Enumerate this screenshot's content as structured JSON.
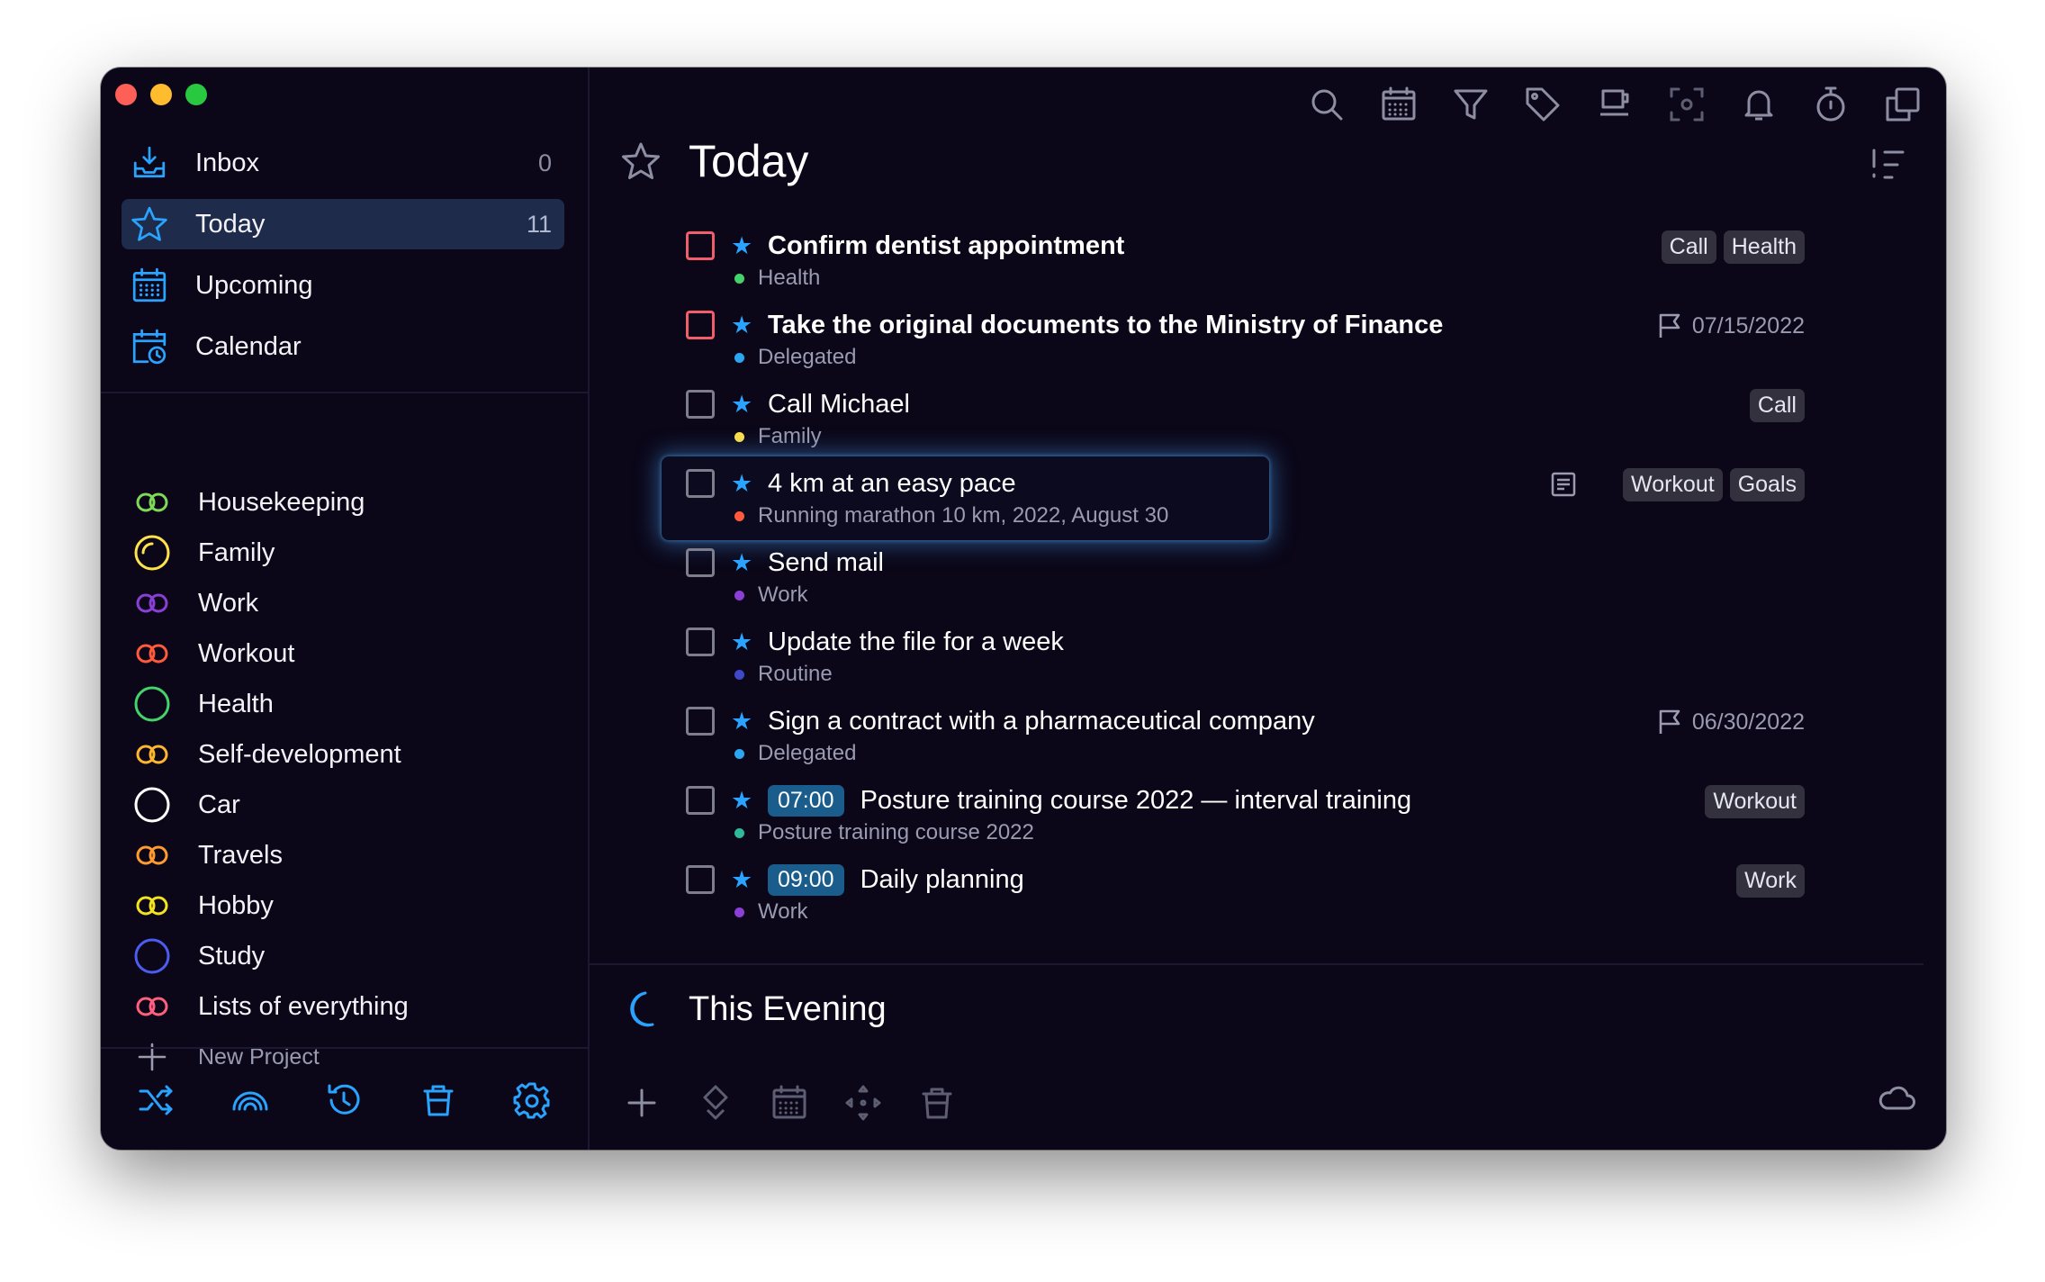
{
  "sidebar": {
    "nav": [
      {
        "label": "Inbox",
        "count": "0",
        "icon": "inbox-icon"
      },
      {
        "label": "Today",
        "count": "11",
        "icon": "star-icon"
      },
      {
        "label": "Upcoming",
        "count": "",
        "icon": "calendar-grid-icon"
      },
      {
        "label": "Calendar",
        "count": "",
        "icon": "calendar-clock-icon"
      }
    ],
    "projects": [
      {
        "label": "Housekeeping",
        "color": "#7ed957"
      },
      {
        "label": "Family",
        "color": "#ffe24a"
      },
      {
        "label": "Work",
        "color": "#8a3fd6"
      },
      {
        "label": "Workout",
        "color": "#ff5a3c"
      },
      {
        "label": "Health",
        "color": "#44d36b"
      },
      {
        "label": "Self-development",
        "color": "#ffb52e"
      },
      {
        "label": "Car",
        "color": "#ffffff"
      },
      {
        "label": "Travels",
        "color": "#ff9a2e"
      },
      {
        "label": "Hobby",
        "color": "#f2e321"
      },
      {
        "label": "Study",
        "color": "#4c5cf0"
      },
      {
        "label": "Lists of everything",
        "color": "#ff5f7e"
      }
    ],
    "new_project": "New Project"
  },
  "main": {
    "title": "Today",
    "tasks": [
      {
        "title": "Confirm dentist appointment",
        "bold": true,
        "red": true,
        "project": "Health",
        "dot": "#44d36b",
        "tags": [
          "Call",
          "Health"
        ]
      },
      {
        "title": "Take the original documents to the Ministry of Finance",
        "bold": true,
        "red": true,
        "project": "Delegated",
        "dot": "#2ba7f0",
        "date": "07/15/2022"
      },
      {
        "title": "Call Michael",
        "project": "Family",
        "dot": "#ffe24a",
        "tags": [
          "Call"
        ]
      },
      {
        "title": "4 km at an easy pace",
        "project": "Running marathon 10 km, 2022, August 30",
        "dot": "#ff5a3c",
        "tags": [
          "Workout",
          "Goals"
        ],
        "note": true,
        "focus": true
      },
      {
        "title": "Send mail",
        "project": "Work",
        "dot": "#8a3fd6"
      },
      {
        "title": "Update the file for a week",
        "project": "Routine",
        "dot": "#3f48c8"
      },
      {
        "title": "Sign a contract with a pharmaceutical company",
        "project": "Delegated",
        "dot": "#2ba7f0",
        "date": "06/30/2022"
      },
      {
        "title": "Posture training course 2022 — interval training",
        "time": "07:00",
        "project": "Posture training course 2022",
        "dot": "#2fb89a",
        "tags": [
          "Workout"
        ]
      },
      {
        "title": "Daily planning",
        "time": "09:00",
        "project": "Work",
        "dot": "#8a3fd6",
        "tags": [
          "Work"
        ]
      }
    ],
    "evening_title": "This Evening"
  },
  "colors": {
    "accent": "#2aa3ff",
    "background": "#0b0719",
    "active_row": "#1e2b4a",
    "tag_bg": "#33313e"
  }
}
